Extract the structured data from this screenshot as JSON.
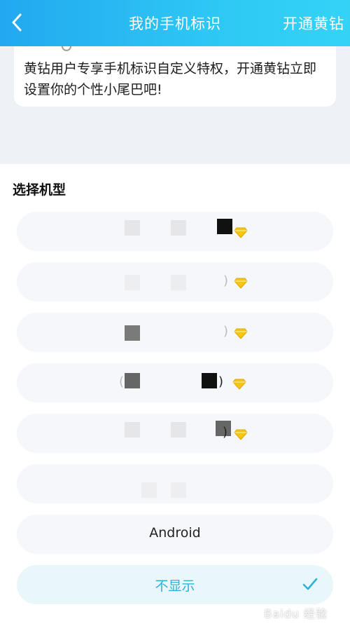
{
  "header": {
    "title": "我的手机标识",
    "action_label": "开通黄钻"
  },
  "notice": {
    "text": "黄钻用户专享手机标识自定义特权，开通黄钻立即设置你的个性小尾巴吧!"
  },
  "section": {
    "title": "选择机型"
  },
  "options": [
    {
      "label": "",
      "vip": true
    },
    {
      "label": "",
      "vip": true
    },
    {
      "label": "",
      "vip": true
    },
    {
      "label": "",
      "vip": true
    },
    {
      "label": "",
      "vip": true
    },
    {
      "label": "",
      "vip": false
    },
    {
      "label": "Android",
      "vip": false
    },
    {
      "label": "不显示",
      "vip": false,
      "selected": true
    }
  ],
  "colors": {
    "header_start": "#22a8f0",
    "header_end": "#34d3f6",
    "selected_text": "#2bb3d8",
    "diamond": "#f6c416"
  },
  "icons": {
    "back": "chevron-left-icon",
    "vip": "yellow-diamond-icon",
    "selected": "checkmark-icon"
  },
  "watermark": {
    "text": "Baidu 经验"
  }
}
